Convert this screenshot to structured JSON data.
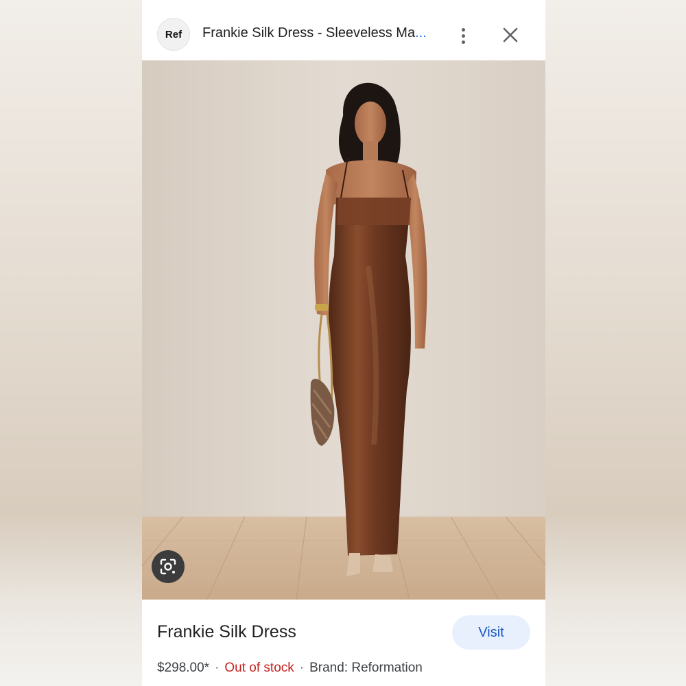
{
  "header": {
    "favicon_text": "Ref",
    "title": "Frankie Silk Dress - Sleeveless Ma",
    "title_truncation": "...",
    "more_icon": "more-vert-icon",
    "close_icon": "close-icon"
  },
  "image": {
    "subject": "Model wearing a brown silk slip maxi dress holding a patterned shoulder bag",
    "lens_icon": "google-lens-icon"
  },
  "product": {
    "name": "Frankie Silk Dress",
    "visit_label": "Visit",
    "price": "$298.00*",
    "separator": "·",
    "stock_status": "Out of stock",
    "brand": "Brand: Reformation"
  },
  "colors": {
    "accent_blue": "#1a73e8",
    "visit_bg": "#e8f0fe",
    "out_of_stock": "#c5221f",
    "dress_brown": "#6e3a22"
  }
}
